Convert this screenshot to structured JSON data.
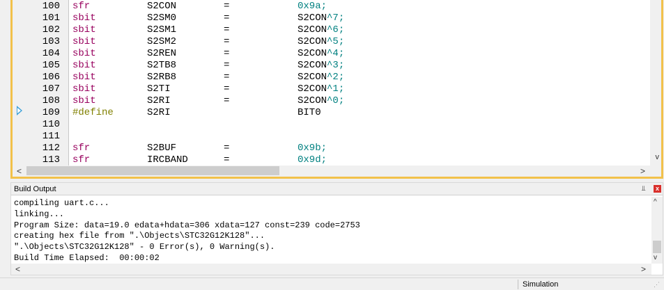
{
  "editor": {
    "lines": [
      {
        "n": "100",
        "kw": "sfr",
        "kw_type": "kw",
        "name": "S2CON",
        "eq": "=",
        "val_text": "",
        "val_num": "0x9a;"
      },
      {
        "n": "101",
        "kw": "sbit",
        "kw_type": "kw",
        "name": "S2SM0",
        "eq": "=",
        "val_text": "S2CON",
        "val_num": "^7;"
      },
      {
        "n": "102",
        "kw": "sbit",
        "kw_type": "kw",
        "name": "S2SM1",
        "eq": "=",
        "val_text": "S2CON",
        "val_num": "^6;"
      },
      {
        "n": "103",
        "kw": "sbit",
        "kw_type": "kw",
        "name": "S2SM2",
        "eq": "=",
        "val_text": "S2CON",
        "val_num": "^5;"
      },
      {
        "n": "104",
        "kw": "sbit",
        "kw_type": "kw",
        "name": "S2REN",
        "eq": "=",
        "val_text": "S2CON",
        "val_num": "^4;"
      },
      {
        "n": "105",
        "kw": "sbit",
        "kw_type": "kw",
        "name": "S2TB8",
        "eq": "=",
        "val_text": "S2CON",
        "val_num": "^3;"
      },
      {
        "n": "106",
        "kw": "sbit",
        "kw_type": "kw",
        "name": "S2RB8",
        "eq": "=",
        "val_text": "S2CON",
        "val_num": "^2;"
      },
      {
        "n": "107",
        "kw": "sbit",
        "kw_type": "kw",
        "name": "S2TI",
        "eq": "=",
        "val_text": "S2CON",
        "val_num": "^1;"
      },
      {
        "n": "108",
        "kw": "sbit",
        "kw_type": "kw",
        "name": "S2RI",
        "eq": "=",
        "val_text": "S2CON",
        "val_num": "^0;"
      },
      {
        "n": "109",
        "kw": "#define",
        "kw_type": "pre",
        "name": "S2RI",
        "eq": "",
        "val_text": "BIT0",
        "val_num": ""
      },
      {
        "n": "110",
        "kw": "",
        "kw_type": "kw",
        "name": "",
        "eq": "",
        "val_text": "",
        "val_num": ""
      },
      {
        "n": "111",
        "kw": "",
        "kw_type": "kw",
        "name": "",
        "eq": "",
        "val_text": "",
        "val_num": ""
      },
      {
        "n": "112",
        "kw": "sfr",
        "kw_type": "kw",
        "name": "S2BUF",
        "eq": "=",
        "val_text": "",
        "val_num": "0x9b;"
      },
      {
        "n": "113",
        "kw": "sfr",
        "kw_type": "kw",
        "name": "IRCBAND",
        "eq": "=",
        "val_text": "",
        "val_num": "0x9d;"
      }
    ],
    "current_line": "109"
  },
  "build_output": {
    "title": "Build Output",
    "pin_glyph": "⫫",
    "close_glyph": "x",
    "lines": [
      "compiling uart.c...",
      "linking...",
      "Program Size: data=19.0 edata+hdata=306 xdata=127 const=239 code=2753",
      "creating hex file from \".\\Objects\\STC32G12K128\"...",
      "\".\\Objects\\STC32G12K128\" - 0 Error(s), 0 Warning(s).",
      "Build Time Elapsed:  00:00:02"
    ]
  },
  "status_bar": {
    "mode": "Simulation"
  },
  "glyphs": {
    "left": "<",
    "right": ">",
    "up": "^",
    "down": "v",
    "grip": "⋰"
  }
}
